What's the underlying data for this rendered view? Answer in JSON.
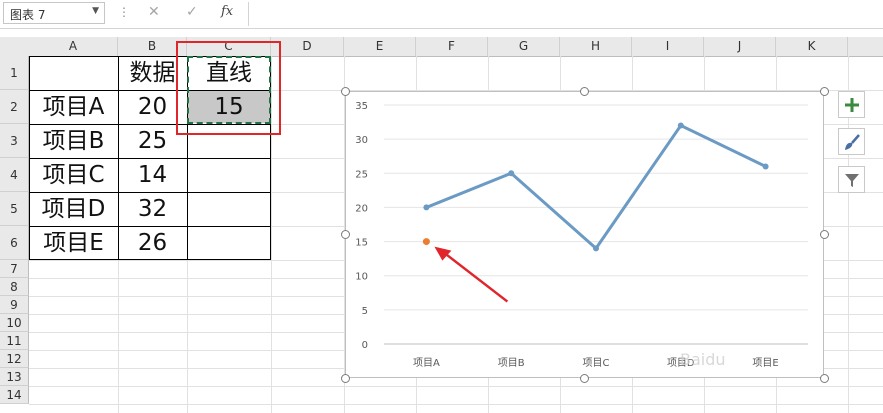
{
  "formula_bar": {
    "name_box": "图表 7",
    "cancel_icon": "✕",
    "confirm_icon": "✓",
    "fx_label": "fx",
    "formula_value": ""
  },
  "columns": [
    "A",
    "B",
    "C",
    "D",
    "E",
    "F",
    "G",
    "H",
    "I",
    "J",
    "K"
  ],
  "rows": [
    "1",
    "2",
    "3",
    "4",
    "5",
    "6",
    "7",
    "8",
    "9",
    "10",
    "11",
    "12",
    "13",
    "14"
  ],
  "cells": {
    "B1": "数据",
    "C1": "直线",
    "A2": "项目A",
    "B2": "20",
    "C2": "15",
    "A3": "项目B",
    "B3": "25",
    "A4": "项目C",
    "B4": "14",
    "A5": "项目D",
    "B5": "32",
    "A6": "项目E",
    "B6": "26"
  },
  "colors": {
    "accent_red": "#e0262b",
    "selection_green": "#217346",
    "line_series": "#6b9ac4",
    "point_series": "#ed7d31",
    "selected_fill": "#c8c8c8"
  },
  "chart_data": {
    "type": "line",
    "categories": [
      "项目A",
      "项目B",
      "项目C",
      "项目D",
      "项目E"
    ],
    "series": [
      {
        "values": [
          20,
          25,
          14,
          32,
          26
        ],
        "color": "#6b9ac4"
      },
      {
        "values": [
          15,
          null,
          null,
          null,
          null
        ],
        "color": "#ed7d31"
      }
    ],
    "yticks": [
      0,
      5,
      10,
      15,
      20,
      25,
      30,
      35
    ],
    "ylim": [
      0,
      35
    ],
    "grid": true,
    "legend": "none",
    "annotation": "red-arrow-pointing-to-orange-point"
  },
  "side_buttons": [
    {
      "icon": "plus-icon"
    },
    {
      "icon": "brush-icon"
    },
    {
      "icon": "filter-icon"
    }
  ],
  "watermark": "Baidu"
}
